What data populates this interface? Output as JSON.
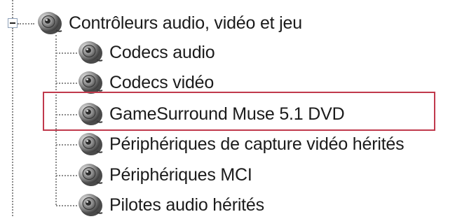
{
  "tree": {
    "root": {
      "label": "Contrôleurs audio, vidéo et jeu",
      "icon": "speaker-icon",
      "expanded": true
    },
    "children": [
      {
        "label": "Codecs audio",
        "icon": "speaker-icon"
      },
      {
        "label": "Codecs vidéo",
        "icon": "speaker-icon"
      },
      {
        "label": "GameSurround Muse 5.1 DVD",
        "icon": "speaker-icon",
        "selected": true
      },
      {
        "label": "Périphériques de capture vidéo hérités",
        "icon": "speaker-icon"
      },
      {
        "label": "Périphériques MCI",
        "icon": "speaker-icon"
      },
      {
        "label": "Pilotes audio hérités",
        "icon": "speaker-icon"
      }
    ]
  },
  "colors": {
    "highlight_border": "#c0394c",
    "tree_lines": "#8c8c8c"
  }
}
